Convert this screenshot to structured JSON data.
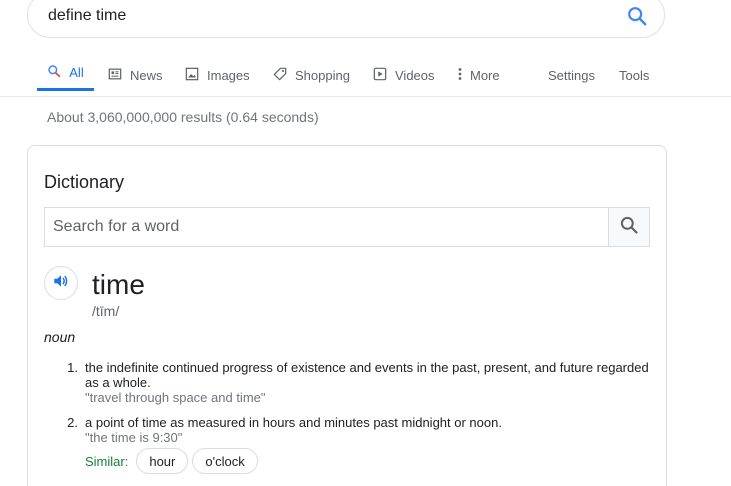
{
  "search": {
    "query": "define time"
  },
  "tabs": {
    "all": "All",
    "news": "News",
    "images": "Images",
    "shopping": "Shopping",
    "videos": "Videos",
    "more": "More",
    "settings": "Settings",
    "tools": "Tools"
  },
  "stats": "About 3,060,000,000 results (0.64 seconds)",
  "dictionary": {
    "title": "Dictionary",
    "search_placeholder": "Search for a word",
    "headword": "time",
    "phonetic": "/tīm/",
    "part_of_speech": "noun",
    "definitions": [
      {
        "number": "1.",
        "text": "the indefinite continued progress of existence and events in the past, present, and future regarded as a whole.",
        "example": "\"travel through space and time\""
      },
      {
        "number": "2.",
        "text": "a point of time as measured in hours and minutes past midnight or noon.",
        "example": "\"the time is 9:30\""
      }
    ],
    "similar_label": "Similar:",
    "similar": [
      "hour",
      "o'clock"
    ]
  },
  "colors": {
    "accent": "#1a73e8",
    "similar_label": "#188038",
    "muted": "#70757a"
  }
}
